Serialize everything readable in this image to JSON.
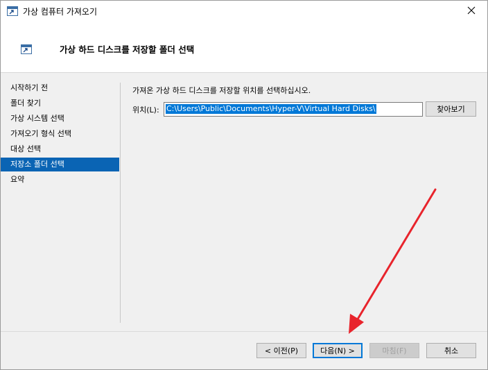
{
  "window": {
    "title": "가상 컴퓨터 가져오기"
  },
  "header": {
    "title": "가상 하드 디스크를 저장할 폴더 선택"
  },
  "nav": {
    "items": [
      {
        "label": "시작하기 전",
        "selected": false
      },
      {
        "label": "폴더 찾기",
        "selected": false
      },
      {
        "label": "가상 시스템 선택",
        "selected": false
      },
      {
        "label": "가져오기 형식 선택",
        "selected": false
      },
      {
        "label": "대상 선택",
        "selected": false
      },
      {
        "label": "저장소 폴더 선택",
        "selected": true
      },
      {
        "label": "요약",
        "selected": false
      }
    ]
  },
  "content": {
    "instruction": "가져온 가상 하드 디스크를 저장할 위치를 선택하십시오.",
    "location_label": "위치(L):",
    "location_value": "C:\\Users\\Public\\Documents\\Hyper-V\\Virtual Hard Disks\\",
    "browse_label": "찾아보기"
  },
  "footer": {
    "prev_label": "< 이전(P)",
    "next_label": "다음(N) >",
    "finish_label": "마침(F)",
    "cancel_label": "취소"
  },
  "colors": {
    "selection": "#0a64b4",
    "annotation_arrow": "#e8242c"
  },
  "icons": {
    "app": "hyper-v-import-icon",
    "close": "close-icon"
  }
}
